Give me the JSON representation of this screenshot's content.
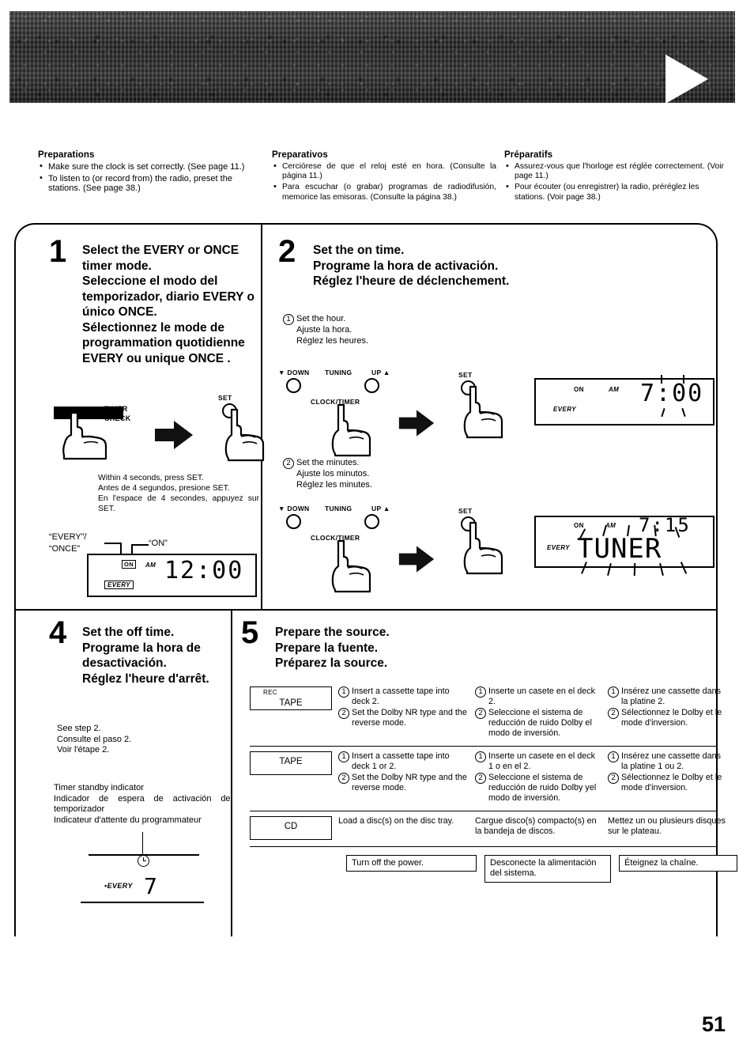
{
  "page": {
    "number": "51"
  },
  "header": {
    "icon": "play-triangle-icon"
  },
  "preparations": {
    "en": {
      "title": "Preparations",
      "items": [
        "Make sure the clock is set correctly. (See page 11.)",
        "To listen to (or record from) the radio, preset the stations. (See page 38.)"
      ]
    },
    "es": {
      "title": "Preparativos",
      "items": [
        "Cerciórese de que el reloj esté en hora. (Consulte la página 11.)",
        "Para escuchar (o grabar) programas de radiodifusión, memorice las emisoras. (Consulte la página 38.)"
      ]
    },
    "fr": {
      "title": "Préparatifs",
      "items": [
        "Assurez-vous que l'horloge est réglée correctement. (Voir page 11.)",
        "Pour écouter (ou enregistrer) la radio, préréglez les stations. (Voir page 38.)"
      ]
    }
  },
  "step1": {
    "number": "1",
    "heading": "Select the EVERY or ONCE timer mode.\nSeleccione el modo del temporizador, diario EVERY o único ONCE.\nSélectionnez le mode de programmation quotidienne EVERY ou unique ONCE .",
    "button_timer_check": "TIMER\nCHECK",
    "button_set": "SET",
    "note": "Within 4 seconds, press SET.\nAntes de 4 segundos, presione SET.\nEn l'espace de 4 secondes, appuyez sur SET.",
    "callout_every_once": "“EVERY”/\n“ONCE”",
    "callout_on": "“ON”",
    "display": {
      "on": "ON",
      "am": "AM",
      "time": "12:00",
      "mode": "EVERY"
    }
  },
  "step2": {
    "number": "2",
    "heading": "Set the on time.\nPrograme la hora de activación.\nRéglez l'heure de déclenchement.",
    "sub1": {
      "marker": "1",
      "text": "Set the hour.\nAjuste la hora.\nRéglez les heures."
    },
    "sub2": {
      "marker": "2",
      "text": "Set the minutes.\nAjuste los minutos.\nRéglez les minutes."
    },
    "controls": {
      "down": "DOWN",
      "tuning": "TUNING",
      "up": "UP",
      "clock_timer": "CLOCK/TIMER",
      "set": "SET"
    },
    "display1": {
      "on": "ON",
      "am": "AM",
      "time": "7:00",
      "mode": "EVERY"
    },
    "display2": {
      "on": "ON",
      "am": "AM",
      "time": "7:15",
      "source": "TUNER",
      "mode": "EVERY"
    }
  },
  "step4": {
    "number": "4",
    "heading": "Set the off time.\nPrograme la hora de desactivación.\nRéglez l'heure d'arrêt.",
    "note": "See step 2.\nConsulte el paso 2.\nVoir l'étape 2.",
    "standby_label": "Timer standby indicator\nIndicador de espera de activación del temporizador\nIndicateur d'attente du programmateur",
    "standby_icon": "clock-icon",
    "standby_display": {
      "mode": "EVERY",
      "time": "7"
    }
  },
  "step5": {
    "number": "5",
    "heading": "Prepare the source.\nPrepare la fuente.\nPréparez la source.",
    "rows": [
      {
        "source_small": "REC",
        "source": "TAPE",
        "en": [
          {
            "n": "1",
            "t": "Insert a cassette tape into deck 2."
          },
          {
            "n": "2",
            "t": "Set the Dolby NR type and the reverse mode."
          }
        ],
        "es": [
          {
            "n": "1",
            "t": "Inserte un casete en el deck 2."
          },
          {
            "n": "2",
            "t": "Seleccione el sistema de reducción de ruido Dolby el modo de inversión."
          }
        ],
        "fr": [
          {
            "n": "1",
            "t": "Insérez une cassette dans la platine 2."
          },
          {
            "n": "2",
            "t": "Sélectionnez le Dolby et le mode d'inversion."
          }
        ]
      },
      {
        "source_small": "",
        "source": "TAPE",
        "en": [
          {
            "n": "1",
            "t": "Insert a cassette tape into deck 1 or 2."
          },
          {
            "n": "2",
            "t": "Set the Dolby NR type and the reverse mode."
          }
        ],
        "es": [
          {
            "n": "1",
            "t": "Inserte un casete en el deck 1 o en el 2."
          },
          {
            "n": "2",
            "t": "Seleccione el sistema de reducción de ruido Dolby yel modo de inversión."
          }
        ],
        "fr": [
          {
            "n": "1",
            "t": "Insérez une cassette dans la platine 1 ou 2."
          },
          {
            "n": "2",
            "t": "Sélectionnez le Dolby et le mode d'inversion."
          }
        ]
      },
      {
        "source_small": "",
        "source": "CD",
        "en": [
          {
            "n": "",
            "t": "Load a disc(s) on the disc tray."
          }
        ],
        "es": [
          {
            "n": "",
            "t": "Cargue disco(s) compacto(s) en la bandeja de discos."
          }
        ],
        "fr": [
          {
            "n": "",
            "t": "Mettez un ou plusieurs disques sur le plateau."
          }
        ]
      }
    ],
    "power_row": {
      "en": "Turn off the power.",
      "es": "Desconecte la alimentación del sistema.",
      "fr": "Éteignez la chaîne."
    }
  }
}
